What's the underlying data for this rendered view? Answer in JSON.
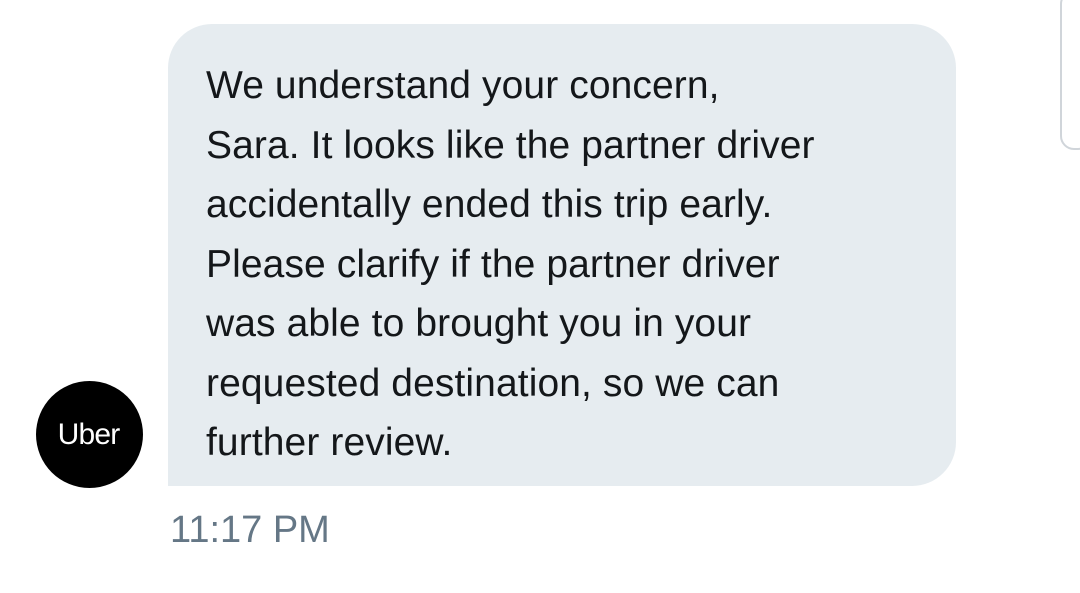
{
  "message": {
    "lines": [
      "We understand your concern,",
      "Sara. It looks like the partner driver",
      "accidentally ended this trip early.",
      "Please clarify if the partner driver",
      "was able to brought you in your",
      "requested destination, so we can",
      "further review."
    ],
    "timestamp": "11:17 PM"
  },
  "sender": {
    "avatar_text": "Uber",
    "avatar_color": "#000000"
  },
  "colors": {
    "bubble_background": "#e6ecf0",
    "message_text": "#14171a",
    "timestamp_text": "#657786"
  }
}
